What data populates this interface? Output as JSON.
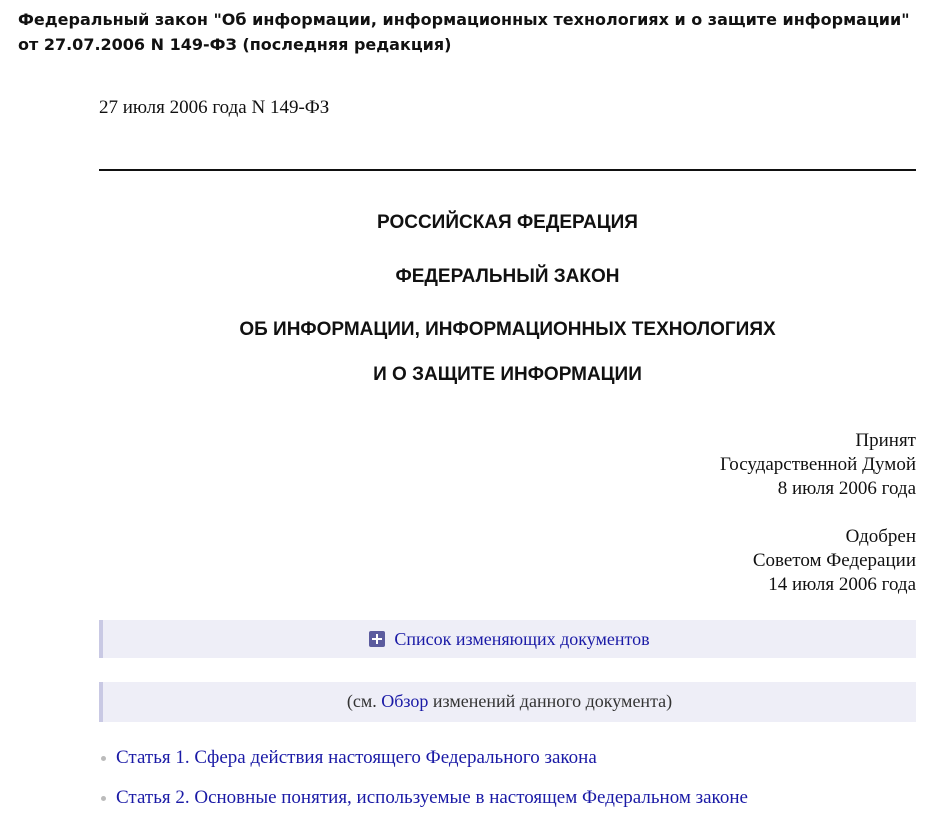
{
  "title": "Федеральный закон \"Об информации, информационных технологиях и о защите информации\" от 27.07.2006 N 149-ФЗ (последняя редакция)",
  "doc_date": "27 июля 2006 года N 149-ФЗ",
  "headings": [
    "РОССИЙСКАЯ ФЕДЕРАЦИЯ",
    "ФЕДЕРАЛЬНЫЙ ЗАКОН",
    "ОБ ИНФОРМАЦИИ, ИНФОРМАЦИОННЫХ ТЕХНОЛОГИЯХ",
    "И О ЗАЩИТЕ ИНФОРМАЦИИ"
  ],
  "adoption": {
    "line1": "Принят",
    "line2": "Государственной Думой",
    "line3": "8 июля 2006 года"
  },
  "approval": {
    "line1": "Одобрен",
    "line2": "Советом Федерации",
    "line3": "14 июля 2006 года"
  },
  "amendments": {
    "label": "Список изменяющих документов",
    "icon": "plus-square-icon"
  },
  "overview": {
    "prefix": "(см. ",
    "link": "Обзор",
    "suffix": " изменений данного документа)"
  },
  "toc": [
    "Статья 1. Сфера действия настоящего Федерального закона",
    "Статья 2. Основные понятия, используемые в настоящем Федеральном законе"
  ],
  "colors": {
    "link": "#1a1aa6",
    "box_bg": "#eeeef7",
    "box_border": "#c9c9e4",
    "icon": "#5b5b9e"
  }
}
